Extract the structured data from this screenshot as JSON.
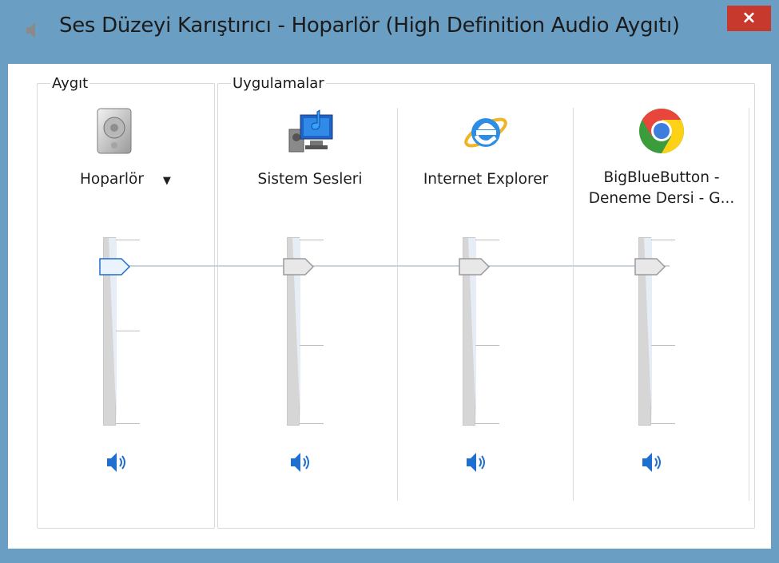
{
  "window": {
    "title": "Ses Düzeyi Karıştırıcı - Hoparlör (High Definition Audio Aygıtı)",
    "close_label": "×",
    "frame_color": "#6a9ec3",
    "close_color": "#c7392c"
  },
  "device_group": {
    "legend": "Aygıt",
    "channel": {
      "name": "Hoparlör",
      "dropdown_glyph": "▼",
      "icon": "speaker-icon",
      "volume_percent": 100,
      "mute_icon": "speaker-unmuted-icon"
    }
  },
  "apps_group": {
    "legend": "Uygulamalar",
    "channels": [
      {
        "name": "Sistem Sesleri",
        "icon": "system-sounds-icon",
        "volume_percent": 100,
        "mute_icon": "speaker-unmuted-icon"
      },
      {
        "name": "Internet Explorer",
        "icon": "internet-explorer-icon",
        "volume_percent": 100,
        "mute_icon": "speaker-unmuted-icon"
      },
      {
        "name_line1": "BigBlueButton -",
        "name_line2": "Deneme Dersi - G...",
        "icon": "chrome-icon",
        "volume_percent": 100,
        "mute_icon": "speaker-unmuted-icon"
      }
    ]
  },
  "colors": {
    "accent_blue": "#1e6fd0",
    "track_fill": "#dce6f1"
  }
}
